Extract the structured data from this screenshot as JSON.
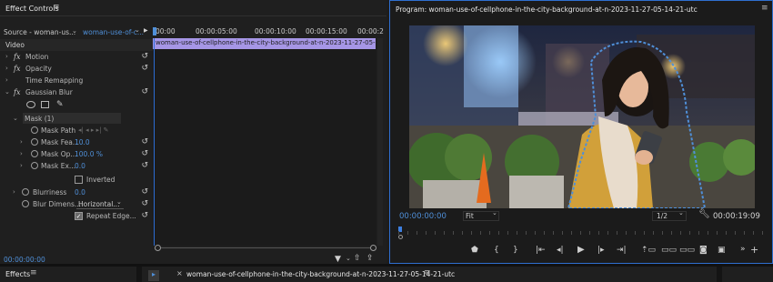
{
  "effect_controls": {
    "title": "Effect Controls",
    "source_label": "Source - woman-us...",
    "clip_label": "woman-use-of-c...",
    "timecodes": [
      "00:00",
      "00:00:05:00",
      "00:00:10:00",
      "00:00:15:00",
      "00:00:2"
    ],
    "clip_bar_label": "woman-use-of-cellphone-in-the-city-background-at-n-2023-11-27-05-14-21-",
    "section_video": "Video",
    "motion": "Motion",
    "opacity": "Opacity",
    "time_remapping": "Time Remapping",
    "gaussian_blur": "Gaussian Blur",
    "mask_name": "Mask (1)",
    "mask_path": "Mask Path",
    "mask_feather_label": "Mask Fea...",
    "mask_feather_value": "10.0",
    "mask_opacity_label": "Mask Op...",
    "mask_opacity_value": "100.0 %",
    "mask_expansion_label": "Mask Ex...",
    "mask_expansion_value": "0.0",
    "inverted_label": "Inverted",
    "blurriness_label": "Blurriness",
    "blurriness_value": "0.0",
    "blur_dim_label": "Blur Dimens...",
    "blur_dim_value": "Horizontal...",
    "repeat_edge_label": "Repeat Edge...",
    "footer_time": "00:00:00:00"
  },
  "program": {
    "title": "Program: woman-use-of-cellphone-in-the-city-background-at-n-2023-11-27-05-14-21-utc",
    "current_time": "00:00:00:00",
    "fit_value": "Fit",
    "resolution_value": "1/2",
    "duration": "00:00:19:09"
  },
  "bottom": {
    "effects_tab": "Effects",
    "sequence_tab": "woman-use-of-cellphone-in-the-city-background-at-n-2023-11-27-05-14-21-utc"
  },
  "colors": {
    "accent": "#4f8fd8",
    "clip": "#a696e6",
    "panel": "#1d1d1d",
    "playhead": "#2d6fd6"
  },
  "icons": [
    "hamburger-icon",
    "play-icon",
    "wrench-icon",
    "marker-icon",
    "mark-in-icon",
    "mark-out-icon",
    "go-to-in-icon",
    "step-back-icon",
    "step-forward-icon",
    "go-to-out-icon",
    "insert-icon",
    "overwrite-icon",
    "lift-icon",
    "extract-icon",
    "export-frame-icon",
    "comparison-icon",
    "plus-icon",
    "reset-icon",
    "stopwatch-icon",
    "filter-icon",
    "export-icon"
  ]
}
